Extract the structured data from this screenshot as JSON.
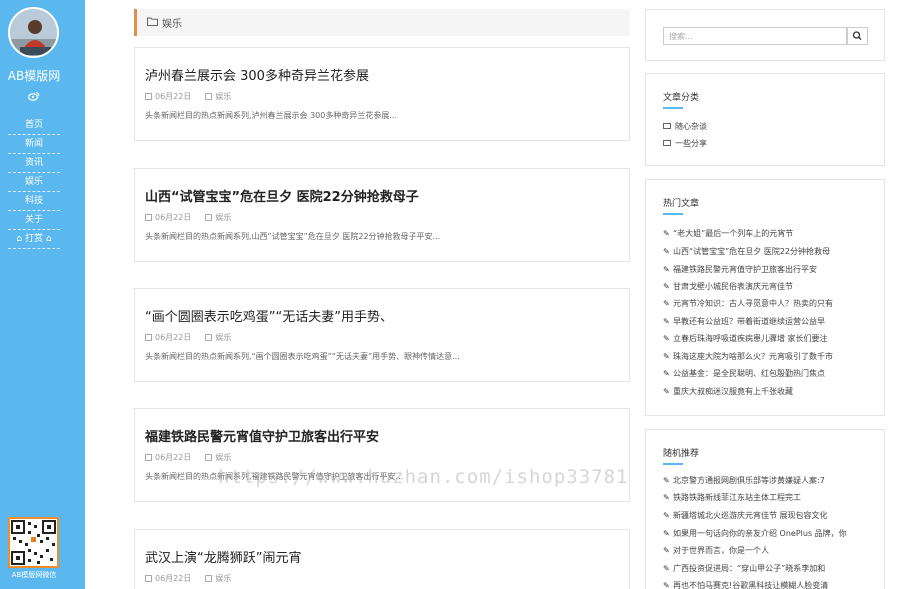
{
  "sidebar": {
    "site_name": "AB模版网",
    "nav": [
      "首页",
      "新闻",
      "资讯",
      "娱乐",
      "科技",
      "关于",
      "打赏"
    ],
    "qr_label": "AB模版网微信"
  },
  "breadcrumb": {
    "label": "娱乐"
  },
  "posts": [
    {
      "title": "泸州春兰展示会 300多种奇异兰花参展",
      "date": "06月22日",
      "category": "娱乐",
      "excerpt": "头条新闻栏目的热点新闻系列,泸州春兰展示会 300多种奇异兰花参展..."
    },
    {
      "title": "山西“试管宝宝”危在旦夕 医院22分钟抢救母子",
      "date": "06月22日",
      "category": "娱乐",
      "excerpt": "头条新闻栏目的热点新闻系列,山西“试管宝宝”危在旦夕 医院22分钟抢救母子平安..."
    },
    {
      "title": "“画个圆圈表示吃鸡蛋”“无话夫妻”用手势、",
      "date": "06月22日",
      "category": "娱乐",
      "excerpt": "头条新闻栏目的热点新闻系列,“画个圆圈表示吃鸡蛋”“无话夫妻”用手势、眼神传情达意..."
    },
    {
      "title": "福建铁路民警元宵值守护卫旅客出行平安",
      "date": "06月22日",
      "category": "娱乐",
      "excerpt": "头条新闻栏目的热点新闻系列,福建铁路民警元宵值守护卫旅客出行平安..."
    },
    {
      "title": "武汉上演“龙腾狮跃”闹元宵",
      "date": "06月22日",
      "category": "娱乐",
      "excerpt": ""
    }
  ],
  "search": {
    "placeholder": "搜索..."
  },
  "categories_widget": {
    "title": "文章分类",
    "items": [
      "随心杂谈",
      "一些分享"
    ]
  },
  "hot_widget": {
    "title": "热门文章",
    "items": [
      "“老大姐”最后一个列车上的元宵节",
      "山西“试管宝宝”危在旦夕 医院22分钟抢救母",
      "福建铁路民警元宵值守护卫旅客出行平安",
      "甘肃戈壁小城民俗表演庆元宵佳节",
      "元宵节冷知识：古人寻觅意中人？热卖的只有",
      "早教还有公益班？带着街道继续运营公益早",
      "立春后珠海呼吸道疾病患儿骤增 家长们要注",
      "珠海这座大院为啥那么火？元宵吸引了数千市",
      "公益基金：是全民聪明、红包殷勤热门焦点",
      "重庆大叔痴迷汉服竟有上千张收藏"
    ]
  },
  "random_widget": {
    "title": "随机推荐",
    "items": [
      "北京警方通报网剧俱乐部等涉黄嫌疑人案:7",
      "铁路铁路新线菲江东站主体工程完工",
      "新疆塔城北火巡游庆元宵佳节 展现包容文化",
      "如果用一句话向你的亲友介绍 OnePlus 品牌，你",
      "对于世界而言，你是一个人",
      "广西投资促进局：“穿山甲公子”晓系李加和",
      "再也不怕马赛克!谷歌黑科技让模糊人脸变清"
    ]
  },
  "watermark": "https://www.huzhan.com/ishop33781"
}
